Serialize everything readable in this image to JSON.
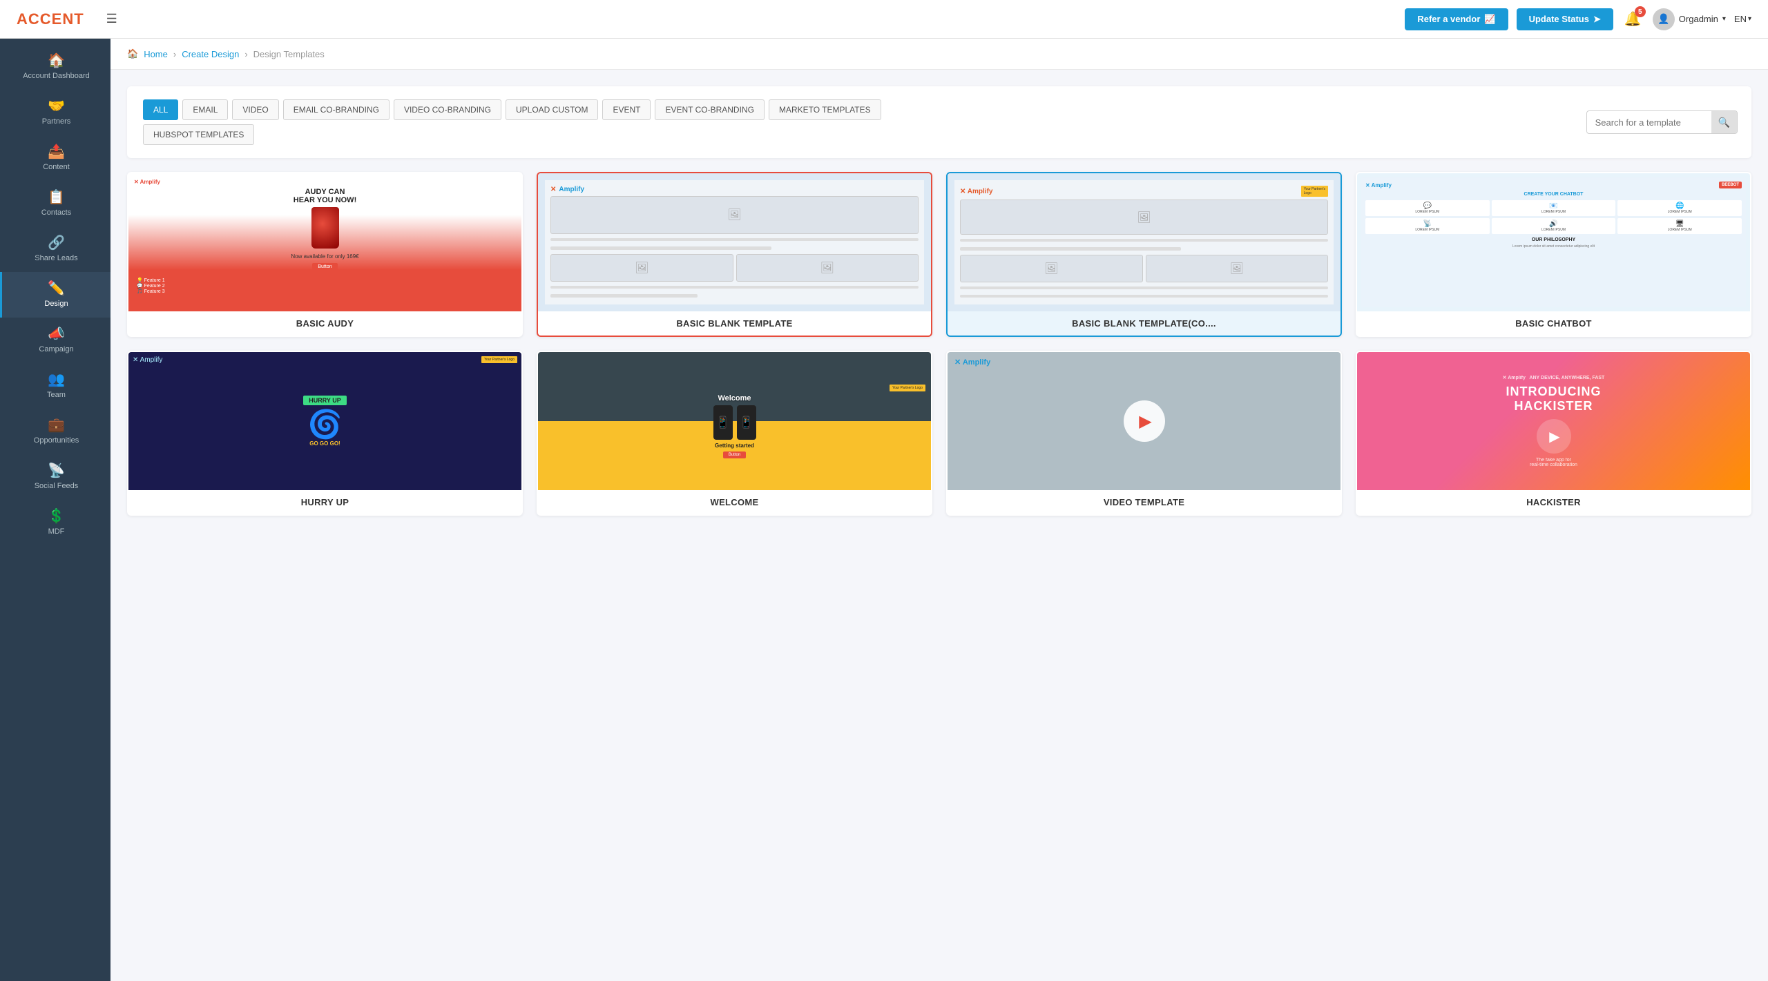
{
  "app": {
    "logo_text": "ACCENT",
    "logo_accent": ""
  },
  "topnav": {
    "refer_vendor": "Refer a vendor",
    "update_status": "Update Status",
    "notif_count": "5",
    "user_name": "Orgadmin",
    "language": "EN"
  },
  "sidebar": {
    "items": [
      {
        "id": "account-dashboard",
        "label": "Account Dashboard",
        "icon": "🏠",
        "active": false
      },
      {
        "id": "partners",
        "label": "Partners",
        "icon": "🤝",
        "active": false
      },
      {
        "id": "content",
        "label": "Content",
        "icon": "📤",
        "active": false
      },
      {
        "id": "contacts",
        "label": "Contacts",
        "icon": "📋",
        "active": false
      },
      {
        "id": "share-leads",
        "label": "Share Leads",
        "icon": "🔗",
        "active": false
      },
      {
        "id": "design",
        "label": "Design",
        "icon": "✏️",
        "active": true
      },
      {
        "id": "campaign",
        "label": "Campaign",
        "icon": "📣",
        "active": false
      },
      {
        "id": "team",
        "label": "Team",
        "icon": "👥",
        "active": false
      },
      {
        "id": "opportunities",
        "label": "Opportunities",
        "icon": "💼",
        "active": false
      },
      {
        "id": "social-feeds",
        "label": "Social Feeds",
        "icon": "📡",
        "active": false
      },
      {
        "id": "mdf",
        "label": "MDF",
        "icon": "💲",
        "active": false
      }
    ]
  },
  "breadcrumb": {
    "home": "Home",
    "create_design": "Create Design",
    "current": "Design Templates"
  },
  "filter_tabs": [
    {
      "id": "all",
      "label": "ALL",
      "active": true
    },
    {
      "id": "email",
      "label": "EMAIL",
      "active": false
    },
    {
      "id": "video",
      "label": "VIDEO",
      "active": false
    },
    {
      "id": "email-cobranding",
      "label": "EMAIL CO-BRANDING",
      "active": false
    },
    {
      "id": "video-cobranding",
      "label": "VIDEO CO-BRANDING",
      "active": false
    },
    {
      "id": "upload-custom",
      "label": "UPLOAD CUSTOM",
      "active": false
    },
    {
      "id": "event",
      "label": "EVENT",
      "active": false
    },
    {
      "id": "event-cobranding",
      "label": "EVENT CO-BRANDING",
      "active": false
    },
    {
      "id": "marketo",
      "label": "MARKETO TEMPLATES",
      "active": false
    },
    {
      "id": "hubspot",
      "label": "HUBSPOT TEMPLATES",
      "active": false
    }
  ],
  "search": {
    "placeholder": "Search for a template"
  },
  "templates": {
    "row1": [
      {
        "id": "basic-audy",
        "name": "BASIC AUDY",
        "selected": false,
        "highlighted": false
      },
      {
        "id": "basic-blank",
        "name": "Basic Blank Template",
        "selected": true,
        "highlighted": false
      },
      {
        "id": "basic-blank-cob",
        "name": "Basic Blank Template(Co....",
        "selected": false,
        "highlighted": true
      },
      {
        "id": "basic-chatbot",
        "name": "BASIC CHATBOT",
        "selected": false,
        "highlighted": false
      }
    ],
    "row2": [
      {
        "id": "hurry-up",
        "name": "HURRY UP",
        "selected": false,
        "highlighted": false
      },
      {
        "id": "welcome",
        "name": "WELCOME",
        "selected": false,
        "highlighted": false
      },
      {
        "id": "video-template",
        "name": "VIDEO TEMPLATE",
        "selected": false,
        "highlighted": false
      },
      {
        "id": "hackister",
        "name": "HACKISTER",
        "selected": false,
        "highlighted": false
      }
    ]
  }
}
